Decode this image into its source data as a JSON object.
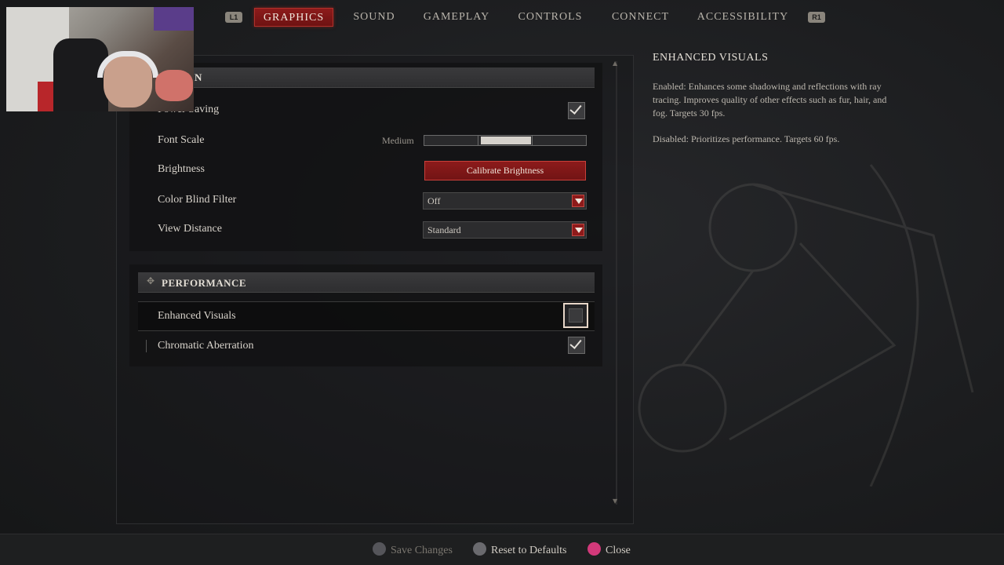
{
  "nav": {
    "left_bumper": "L1",
    "right_bumper": "R1",
    "tabs": [
      {
        "label": "GRAPHICS",
        "active": true
      },
      {
        "label": "SOUND",
        "active": false
      },
      {
        "label": "GAMEPLAY",
        "active": false
      },
      {
        "label": "CONTROLS",
        "active": false
      },
      {
        "label": "CONNECT",
        "active": false
      },
      {
        "label": "ACCESSIBILITY",
        "active": false
      }
    ]
  },
  "display_section": {
    "title_visible": "N",
    "rows": {
      "power_saving": {
        "label": "Power Saving",
        "checked": true
      },
      "font_scale": {
        "label": "Font Scale",
        "value": "Medium"
      },
      "brightness": {
        "label": "Brightness",
        "button": "Calibrate Brightness"
      },
      "color_blind": {
        "label": "Color Blind Filter",
        "value": "Off"
      },
      "view_distance": {
        "label": "View Distance",
        "value": "Standard"
      }
    }
  },
  "performance_section": {
    "title": "PERFORMANCE",
    "rows": {
      "enhanced_visuals": {
        "label": "Enhanced Visuals",
        "checked": false
      },
      "chromatic_aberration": {
        "label": "Chromatic Aberration",
        "checked": true
      }
    }
  },
  "info": {
    "title": "ENHANCED VISUALS",
    "enabled": "Enabled: Enhances some shadowing and reflections with ray tracing. Improves quality of other effects such as fur, hair, and fog. Targets 30 fps.",
    "disabled": "Disabled: Prioritizes performance. Targets 60 fps."
  },
  "bottom": {
    "save": "Save Changes",
    "reset": "Reset to Defaults",
    "close": "Close"
  },
  "colors": {
    "accent_red": "#8d1b1b",
    "triangle": "#5a5a5c",
    "circle": "#d2397a"
  }
}
